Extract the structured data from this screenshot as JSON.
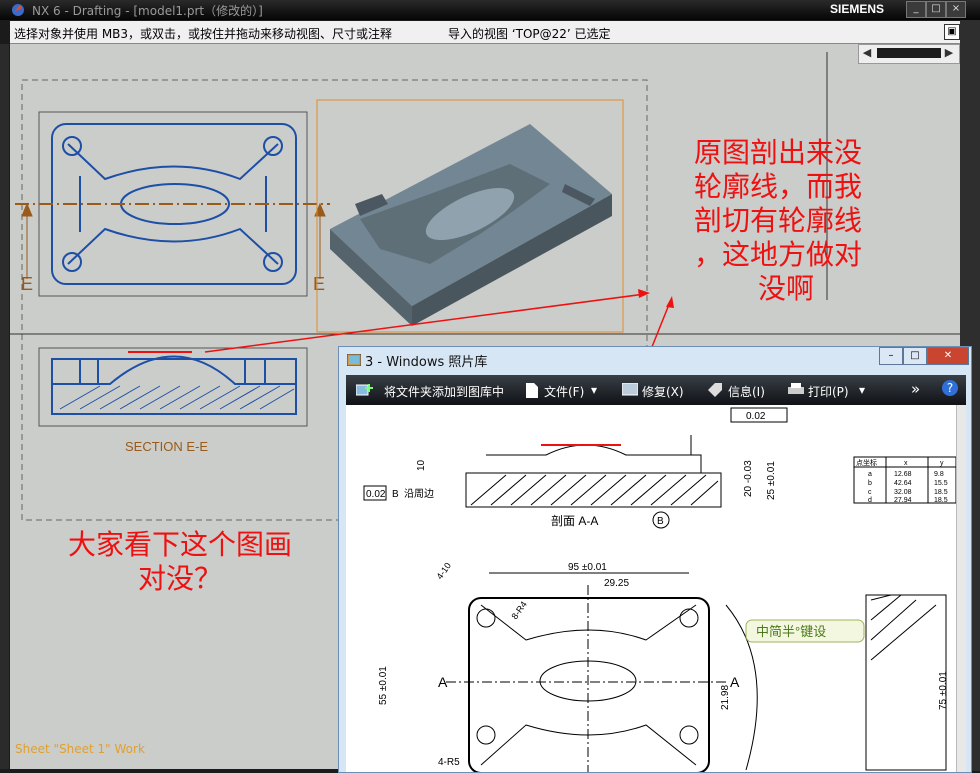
{
  "window": {
    "title": "NX 6 - Drafting - [model1.prt（修改的）]",
    "brand": "SIEMENS",
    "min_label": "_",
    "max_label": "□",
    "close_label": "×"
  },
  "statusbar": {
    "prompt": "选择对象并使用 MB3，或双击，或按住并拖动来移动视图、尺寸或注释",
    "selection": "导入的视图 ‘TOP@22’ 已选定"
  },
  "drawing": {
    "left_label": "E",
    "right_label": "E",
    "section_label": "SECTION  E-E",
    "sheet_label": "Sheet \"Sheet 1\" Work"
  },
  "notes": {
    "right": [
      "原图剖出来没",
      "轮廓线，而我",
      "剖切有轮廓线",
      "，这地方做对",
      "没啊"
    ],
    "left": [
      "大家看下这个图画",
      "对没？"
    ]
  },
  "photo_viewer": {
    "title": "3 - Windows 照片库",
    "toolbar": {
      "add": "将文件夹添加到图库中",
      "file": "文件(F)",
      "fix": "修复(X)",
      "info": "信息(I)",
      "print": "打印(P)",
      "more": "»",
      "help": "?"
    },
    "drawing": {
      "section_label": "剖面 A-A",
      "tol_1": "0.02",
      "tol_2": "0.02",
      "datum_b": "B",
      "edge_note": "沿周边",
      "dim_95": "95 ±0.01",
      "dim_29": "29.25",
      "dim_55": "55 ±0.01",
      "dim_21": "21.98",
      "dim_20": "20 -0.03",
      "dim_25": "25 ±0.01",
      "dim_75": "75 ±0.01",
      "dim_10": "10",
      "dim_4r5": "4-R5",
      "dim_8r4": "8-R4",
      "dim_4_10": "4-10",
      "section_a": "A",
      "watermark": "中简半°键设",
      "table_headers": [
        "点坐标",
        "x",
        "y"
      ],
      "table_rows": [
        [
          "a",
          "12.68",
          "9.8"
        ],
        [
          "b",
          "42.64",
          "15.5"
        ],
        [
          "c",
          "32.08",
          "18.5"
        ],
        [
          "d",
          "27.94",
          "18.5"
        ]
      ]
    }
  }
}
